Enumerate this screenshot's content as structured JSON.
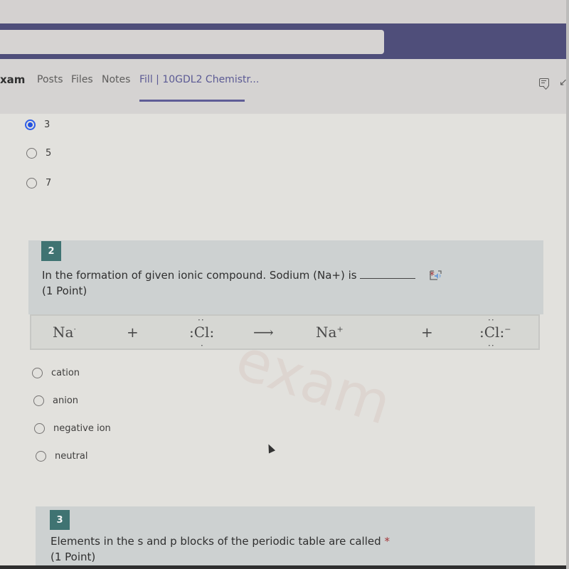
{
  "header": {
    "app_name": "xam",
    "tabs": [
      {
        "label": "Posts"
      },
      {
        "label": "Files"
      },
      {
        "label": "Notes"
      },
      {
        "label": "Fill | 10GDL2 Chemistr...",
        "active": true
      }
    ],
    "icons": [
      "chat-icon",
      "expand-icon"
    ],
    "accent_color": "#5f5d96"
  },
  "question1": {
    "options": [
      {
        "label": "3",
        "selected": true
      },
      {
        "label": "5",
        "selected": false
      },
      {
        "label": "7",
        "selected": false
      }
    ]
  },
  "question2": {
    "number": "2",
    "text": "In the formation of given ionic compound. Sodium (Na+) is",
    "points": "(1 Point)",
    "required_mark": "*",
    "equation": {
      "reactant1": "Na",
      "plus1": "+",
      "reactant2": ":Cl:",
      "arrow": "⟶",
      "product1": "Na",
      "product1_charge": "+",
      "plus2": "+",
      "product2": ":Cl:",
      "product2_charge": "−"
    },
    "options": [
      {
        "label": "cation"
      },
      {
        "label": "anion"
      },
      {
        "label": "negative ion"
      },
      {
        "label": "neutral"
      }
    ]
  },
  "question3": {
    "number": "3",
    "text": "Elements in the s and p blocks of the periodic table are called",
    "required_mark": "*",
    "points": "(1 Point)"
  },
  "watermark": "exam",
  "colors": {
    "question_number_bg": "#3f7372",
    "card_bg": "#cdd1d1",
    "radio_selected": "#2352e0",
    "required": "#a4373a"
  }
}
